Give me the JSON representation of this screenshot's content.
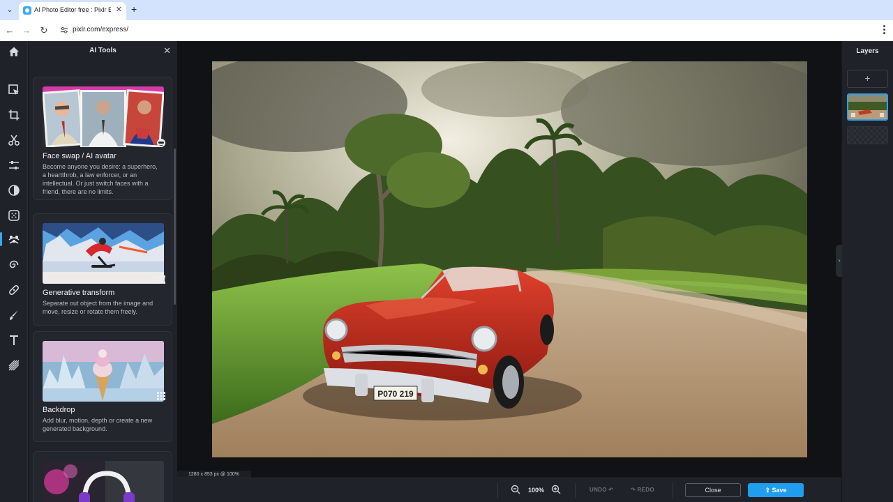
{
  "browser": {
    "tab_title": "AI Photo Editor free : Pixlr Express",
    "tab_close": "✕",
    "new_tab": "+",
    "url": "pixlr.com/express/",
    "tab_list": "⌄"
  },
  "rail": {
    "items": [
      {
        "name": "home-icon"
      },
      {
        "name": "arrange-icon"
      },
      {
        "name": "crop-icon"
      },
      {
        "name": "cutout-icon"
      },
      {
        "name": "adjust-icon"
      },
      {
        "name": "filter-icon"
      },
      {
        "name": "effect-icon"
      },
      {
        "name": "ai-tools-icon",
        "active": true
      },
      {
        "name": "liquify-icon"
      },
      {
        "name": "retouch-icon"
      },
      {
        "name": "draw-icon"
      },
      {
        "name": "text-icon"
      },
      {
        "name": "elements-icon"
      }
    ]
  },
  "panel": {
    "title": "AI Tools",
    "close": "✕",
    "cards": [
      {
        "title": "Face swap / AI avatar",
        "desc": "Become anyone you desire: a superhero, a heartthrob, a law enforcer, or an intellectual. Or just switch faces with a friend, there are no limits.",
        "badge": "face-swap-icon"
      },
      {
        "title": "Generative transform",
        "desc": "Separate out object from the image and move, resize or rotate them freely.",
        "badge": "transform-icon"
      },
      {
        "title": "Backdrop",
        "desc": "Add blur, motion, depth or create a new generated background.",
        "badge": "backdrop-icon"
      }
    ]
  },
  "canvas": {
    "size_readout": "1280 x 853 px @ 100%",
    "zoom": "100%",
    "undo": "UNDO",
    "redo": "REDO",
    "close": "Close",
    "save": "Save",
    "collapse": "›"
  },
  "layers": {
    "title": "Layers",
    "add": "+"
  },
  "colors": {
    "accent": "#1f9ef0",
    "panel_bg": "#1f2228",
    "workspace_bg": "#101216"
  }
}
